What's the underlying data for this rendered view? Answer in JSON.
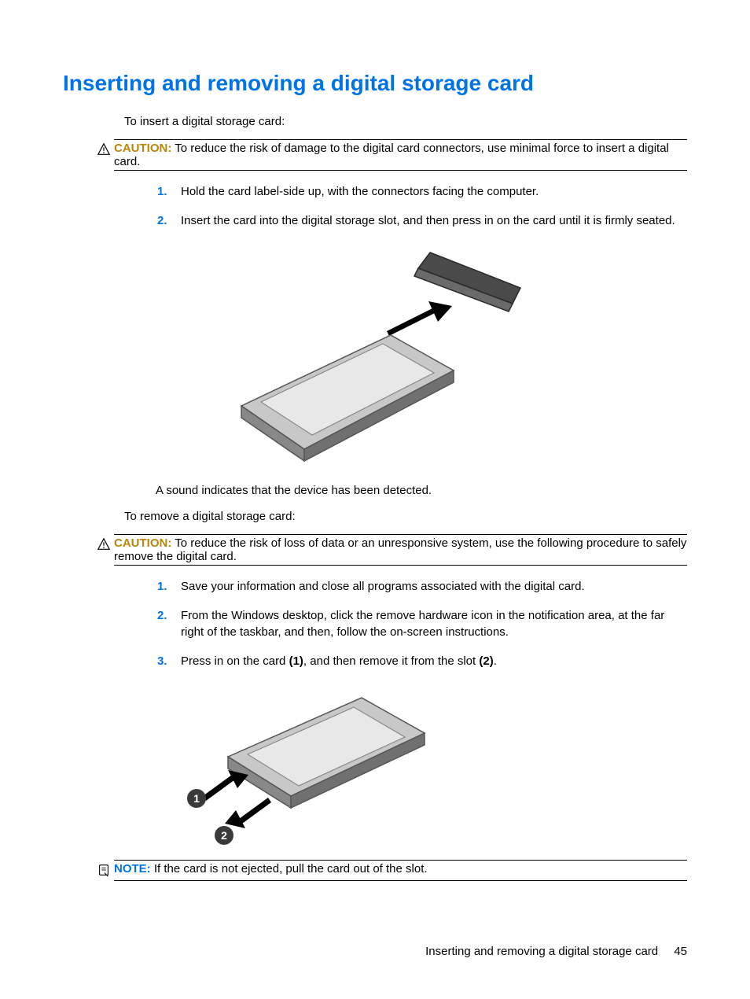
{
  "heading": "Inserting and removing a digital storage card",
  "insert_intro": "To insert a digital storage card:",
  "caution1": {
    "label": "CAUTION:",
    "text": "To reduce the risk of damage to the digital card connectors, use minimal force to insert a digital card."
  },
  "insert_steps": [
    "Hold the card label-side up, with the connectors facing the computer.",
    "Insert the card into the digital storage slot, and then press in on the card until it is firmly seated."
  ],
  "sound_text": "A sound indicates that the device has been detected.",
  "remove_intro": "To remove a digital storage card:",
  "caution2": {
    "label": "CAUTION:",
    "text": "To reduce the risk of loss of data or an unresponsive system, use the following procedure to safely remove the digital card."
  },
  "remove_steps": {
    "s1": "Save your information and close all programs associated with the digital card.",
    "s2": "From the Windows desktop, click the remove hardware icon in the notification area, at the far right of the taskbar, and then, follow the on-screen instructions.",
    "s3_pre": "Press in on the card ",
    "s3_b1": "(1)",
    "s3_mid": ", and then remove it from the slot ",
    "s3_b2": "(2)",
    "s3_post": "."
  },
  "note": {
    "label": "NOTE:",
    "text": "If the card is not ejected, pull the card out of the slot."
  },
  "footer": {
    "text": "Inserting and removing a digital storage card",
    "page": "45"
  }
}
